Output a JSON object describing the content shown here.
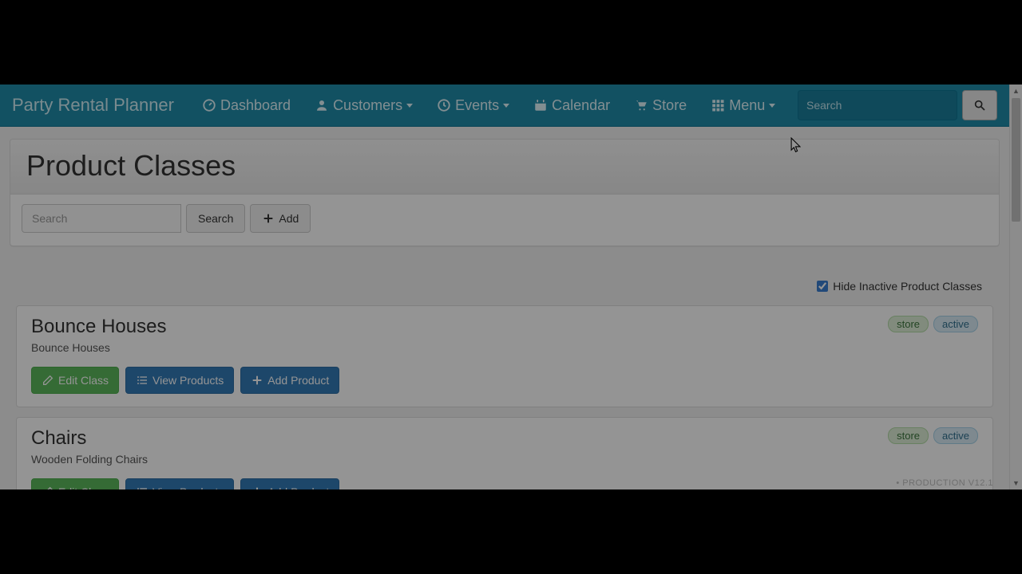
{
  "brand": "Party Rental Planner",
  "nav": {
    "dashboard": "Dashboard",
    "customers": "Customers",
    "events": "Events",
    "calendar": "Calendar",
    "store": "Store",
    "menu": "Menu",
    "search_placeholder": "Search"
  },
  "page": {
    "title": "Product Classes",
    "search_placeholder": "Search",
    "search_btn": "Search",
    "add_btn": "Add",
    "hide_inactive_label": "Hide Inactive Product Classes",
    "hide_inactive_checked": true
  },
  "buttons": {
    "edit_class": "Edit Class",
    "view_products": "View Products",
    "add_product": "Add Product"
  },
  "badges": {
    "store": "store",
    "active": "active"
  },
  "classes": [
    {
      "title": "Bounce Houses",
      "subtitle": "Bounce Houses"
    },
    {
      "title": "Chairs",
      "subtitle": "Wooden Folding Chairs"
    }
  ],
  "footer": "• PRODUCTION V12.1"
}
